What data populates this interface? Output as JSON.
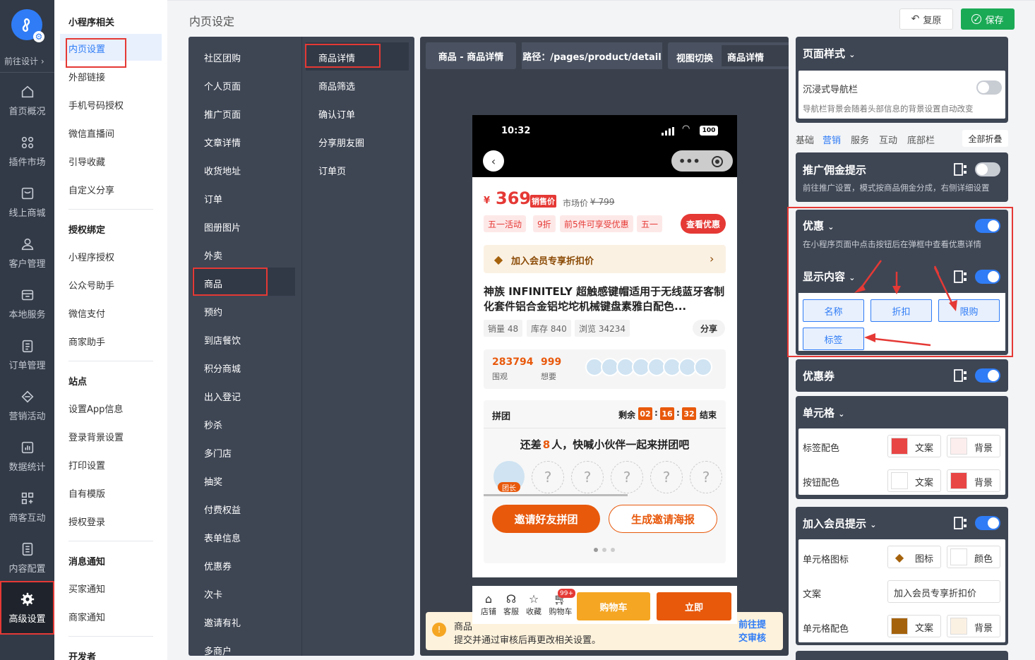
{
  "rail": {
    "design_label": "前往设计 ›",
    "items": [
      {
        "label": "首页概况",
        "icon": "home-icon"
      },
      {
        "label": "插件市场",
        "icon": "grid-icon"
      },
      {
        "label": "线上商城",
        "icon": "shop-icon"
      },
      {
        "label": "客户管理",
        "icon": "user-icon"
      },
      {
        "label": "本地服务",
        "icon": "store-icon"
      },
      {
        "label": "订单管理",
        "icon": "order-icon"
      },
      {
        "label": "营销活动",
        "icon": "diamond-icon"
      },
      {
        "label": "数据统计",
        "icon": "chart-icon"
      },
      {
        "label": "商客互动",
        "icon": "interaction-icon"
      },
      {
        "label": "内容配置",
        "icon": "content-icon"
      },
      {
        "label": "高级设置",
        "icon": "gear-icon"
      }
    ]
  },
  "menu2": {
    "sections": [
      {
        "title": "小程序相关",
        "items": [
          "内页设置",
          "外部链接",
          "手机号码授权",
          "微信直播间",
          "引导收藏",
          "自定义分享"
        ]
      },
      {
        "title": "授权绑定",
        "items": [
          "小程序授权",
          "公众号助手",
          "微信支付",
          "商家助手"
        ]
      },
      {
        "title": "站点",
        "items": [
          "设置App信息",
          "登录背景设置",
          "打印设置",
          "自有模版",
          "授权登录"
        ]
      },
      {
        "title": "消息通知",
        "items": [
          "买家通知",
          "商家通知"
        ]
      },
      {
        "title": "开发者",
        "items": []
      }
    ]
  },
  "header": {
    "title": "内页设定",
    "restore_label": "复原",
    "save_label": "保存"
  },
  "page_list": [
    "社区团购",
    "个人页面",
    "推广页面",
    "文章详情",
    "收货地址",
    "订单",
    "图册图片",
    "外卖",
    "商品",
    "预约",
    "到店餐饮",
    "积分商城",
    "出入登记",
    "秒杀",
    "多门店",
    "抽奖",
    "付费权益",
    "表单信息",
    "优惠券",
    "次卡",
    "邀请有礼",
    "多商户"
  ],
  "sub_pages": [
    "商品详情",
    "商品筛选",
    "确认订单",
    "分享朋友圈",
    "订单页"
  ],
  "preview_bar": {
    "page_name": "商品 - 商品详情",
    "path": "路径：/pages/product/detail",
    "view_switch_label": "视图切换",
    "view_switch_value": "商品详情"
  },
  "phone": {
    "time": "10:32",
    "battery": "100",
    "currency": "¥",
    "price": "369",
    "price_badge": "销售价",
    "market_label": "市场价",
    "market_price": "¥ 799",
    "tags": [
      "五一活动",
      "9折",
      "前5件可享受优惠",
      "五一"
    ],
    "see_discount": "查看优惠",
    "member_text": "加入会员专享折扣价",
    "product_title": "神族 INFINITELY 超触感键帽适用于无线蓝牙客制化套件铝合金铝坨坨机械键盘素雅白配色...",
    "stats": [
      "销量 48",
      "库存 840",
      "浏览 34234"
    ],
    "share": "分享",
    "views_num": "283794",
    "views_label": "围观",
    "want_num": "999",
    "want_label": "想要",
    "group_title": "拼团",
    "remain_label": "剩余",
    "countdown": [
      "02",
      "16",
      "32"
    ],
    "end_label": "结束",
    "need_prefix": "还差",
    "need_num": "8",
    "need_suffix": "人，快喊小伙伴一起来拼团吧",
    "leader_label": "团长",
    "slot_mark": "?",
    "invite_btn": "邀请好友拼团",
    "poster_btn": "生成邀请海报",
    "bottom_icons": [
      "店铺",
      "客服",
      "收藏",
      "购物车"
    ],
    "cart_badge": "99+",
    "cart_btn": "购物车",
    "buy_btn": "立即"
  },
  "notice": {
    "text_line1": "商品",
    "text_line2": "提交并通过审核后再更改相关设置。",
    "link": "前往提交审核"
  },
  "right": {
    "page_style": "页面样式",
    "immersive_nav": "沉浸式导航栏",
    "immersive_desc": "导航栏背景会随着头部信息的背景设置自动改变",
    "tabs": [
      "基础",
      "营销",
      "服务",
      "互动",
      "底部栏"
    ],
    "collapse_all": "全部折叠",
    "promo_title": "推广佣金提示",
    "promo_desc": "前往推广设置，模式按商品佣金分成，右侧详细设置",
    "discount_title": "优惠",
    "discount_desc": "在小程序页面中点击按钮后在弹框中查看优惠详情",
    "display_content": "显示内容",
    "chips": [
      "名称",
      "折扣",
      "限购",
      "标签"
    ],
    "coupon_title": "优惠券",
    "cell_title": "单元格",
    "tag_color": "标签配色",
    "btn_color": "按钮配色",
    "text_label": "文案",
    "bg_label": "背景",
    "member_title": "加入会员提示",
    "cell_icon": "单元格图标",
    "icon_label": "图标",
    "color_label": "颜色",
    "copy_label": "文案",
    "copy_value": "加入会员专享折扣价",
    "cell_color": "单元格配色"
  },
  "colors": {
    "accent": "#2f7cf6",
    "brand_green": "#1aaa55",
    "price_red": "#e53935",
    "group_orange": "#e8590c"
  }
}
